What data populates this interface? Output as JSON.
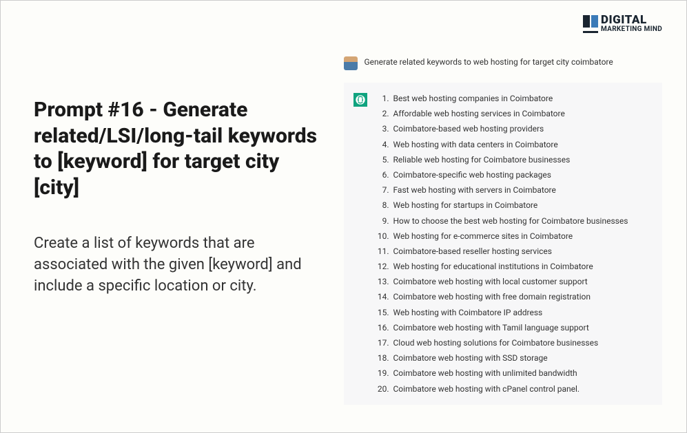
{
  "logo": {
    "text_top": "DIGITAL",
    "text_bottom": "MARKETING MIND"
  },
  "heading": "Prompt #16 - Generate related/LSI/long-tail keywords to [keyword] for target city [city]",
  "description": "Create a list of keywords that are associated with the given [keyword] and include a specific location or city.",
  "prompt": "Generate related keywords to web hosting for target city coimbatore",
  "keywords": [
    "Best web hosting companies in Coimbatore",
    "Affordable web hosting services in Coimbatore",
    "Coimbatore-based web hosting providers",
    "Web hosting with data centers in Coimbatore",
    "Reliable web hosting for Coimbatore businesses",
    "Coimbatore-specific web hosting packages",
    "Fast web hosting with servers in Coimbatore",
    "Web hosting for startups in Coimbatore",
    "How to choose the best web hosting for Coimbatore businesses",
    "Web hosting for e-commerce sites in Coimbatore",
    "Coimbatore-based reseller hosting services",
    "Web hosting for educational institutions in Coimbatore",
    "Coimbatore web hosting with local customer support",
    "Coimbatore web hosting with free domain registration",
    "Web hosting with Coimbatore IP address",
    "Coimbatore web hosting with Tamil language support",
    "Cloud web hosting solutions for Coimbatore businesses",
    "Coimbatore web hosting with SSD storage",
    "Coimbatore web hosting with unlimited bandwidth",
    "Coimbatore web hosting with cPanel control panel."
  ]
}
